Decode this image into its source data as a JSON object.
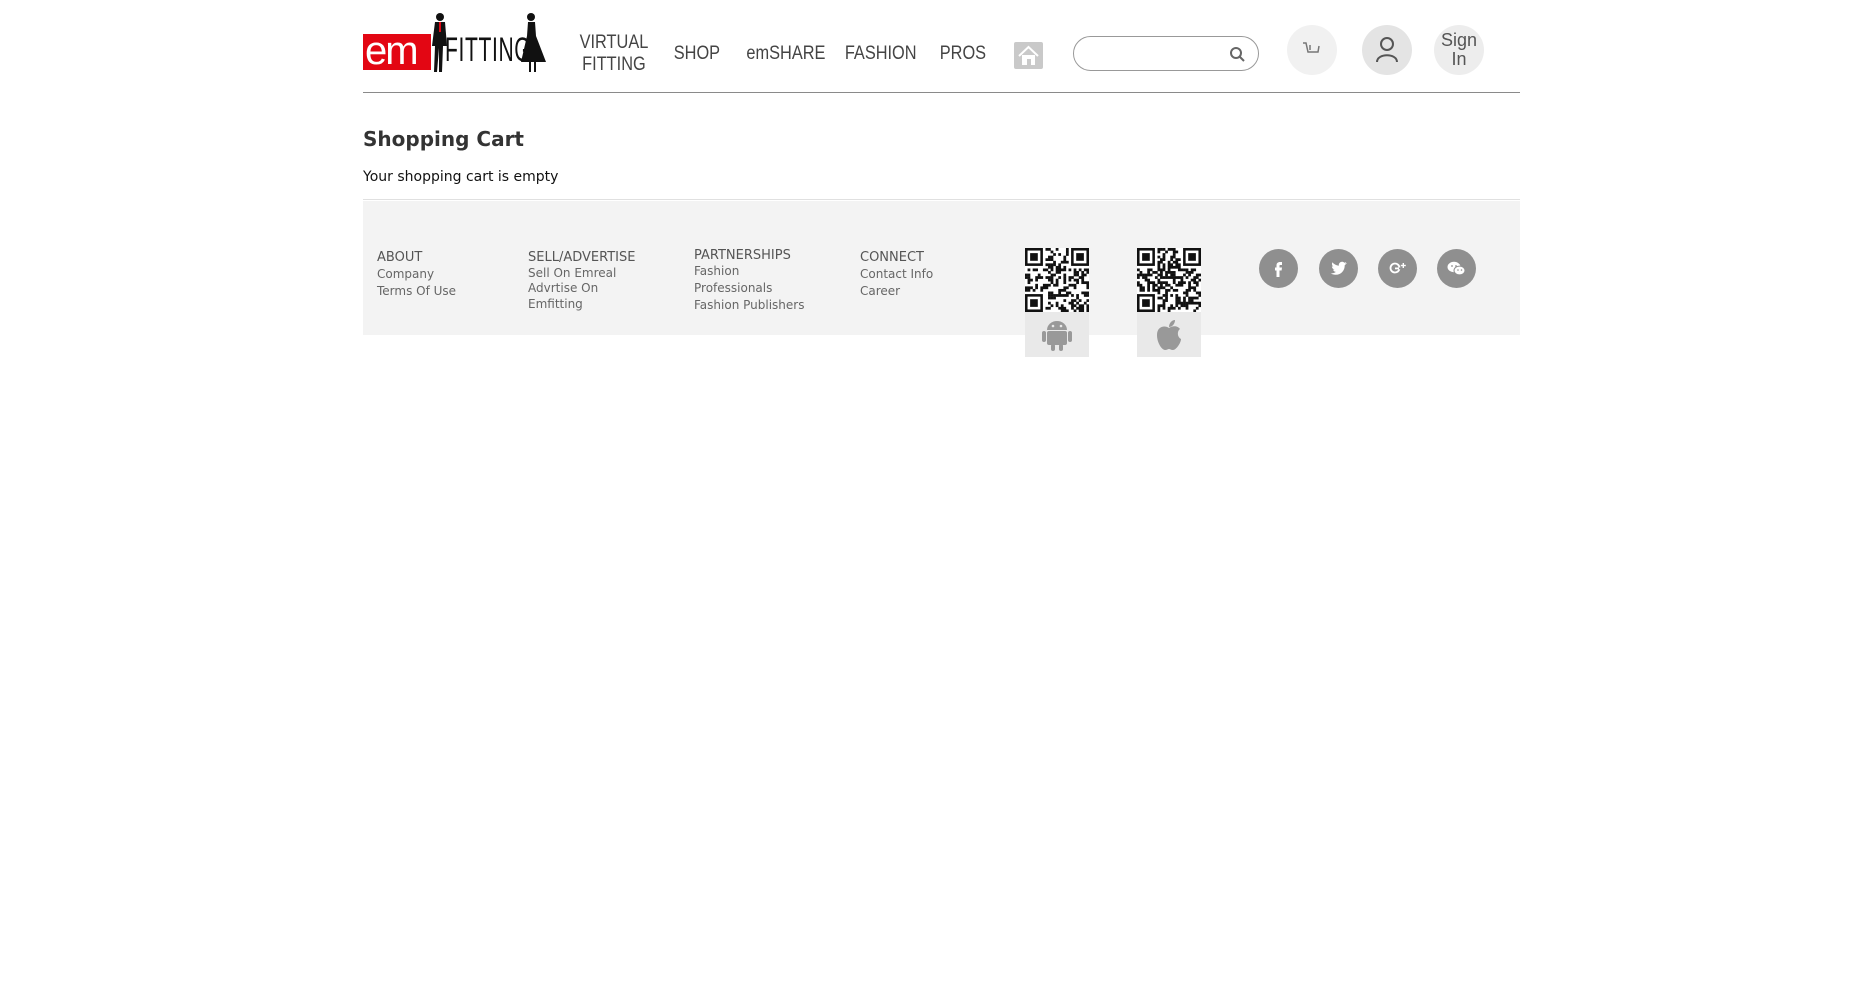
{
  "header": {
    "logo": {
      "em": "em",
      "fitting": "FITTING"
    },
    "nav": [
      {
        "label_line1": "VIRTUAL",
        "label_line2": "FITTING"
      },
      {
        "label": "SHOP"
      },
      {
        "label": "emSHARE"
      },
      {
        "label": "FASHION"
      },
      {
        "label": "PROS"
      }
    ],
    "search": {
      "value": "",
      "placeholder": ""
    },
    "signin_line1": "Sign",
    "signin_line2": "In"
  },
  "main": {
    "title": "Shopping Cart",
    "empty_message": "Your shopping cart is empty"
  },
  "footer": {
    "columns": [
      {
        "heading": "ABOUT",
        "links": [
          "Company",
          "Terms Of Use"
        ]
      },
      {
        "heading": "SELL/ADVERTISE",
        "links": [
          "Sell On Emreal",
          "Advrtise On",
          "Emfitting"
        ]
      },
      {
        "heading": "PARTNERSHIPS",
        "links": [
          "Fashion",
          "Professionals",
          "Fashion Publishers"
        ]
      },
      {
        "heading": "CONNECT",
        "links": [
          "Contact Info",
          "Career"
        ]
      }
    ],
    "apps": [
      "android-icon",
      "apple-icon"
    ],
    "social": [
      "facebook-icon",
      "twitter-icon",
      "google-plus-icon",
      "wechat-icon"
    ]
  },
  "colors": {
    "brand_red": "#e30613",
    "social_gray": "#8f8f8f",
    "footer_bg": "#f3f3f3"
  }
}
